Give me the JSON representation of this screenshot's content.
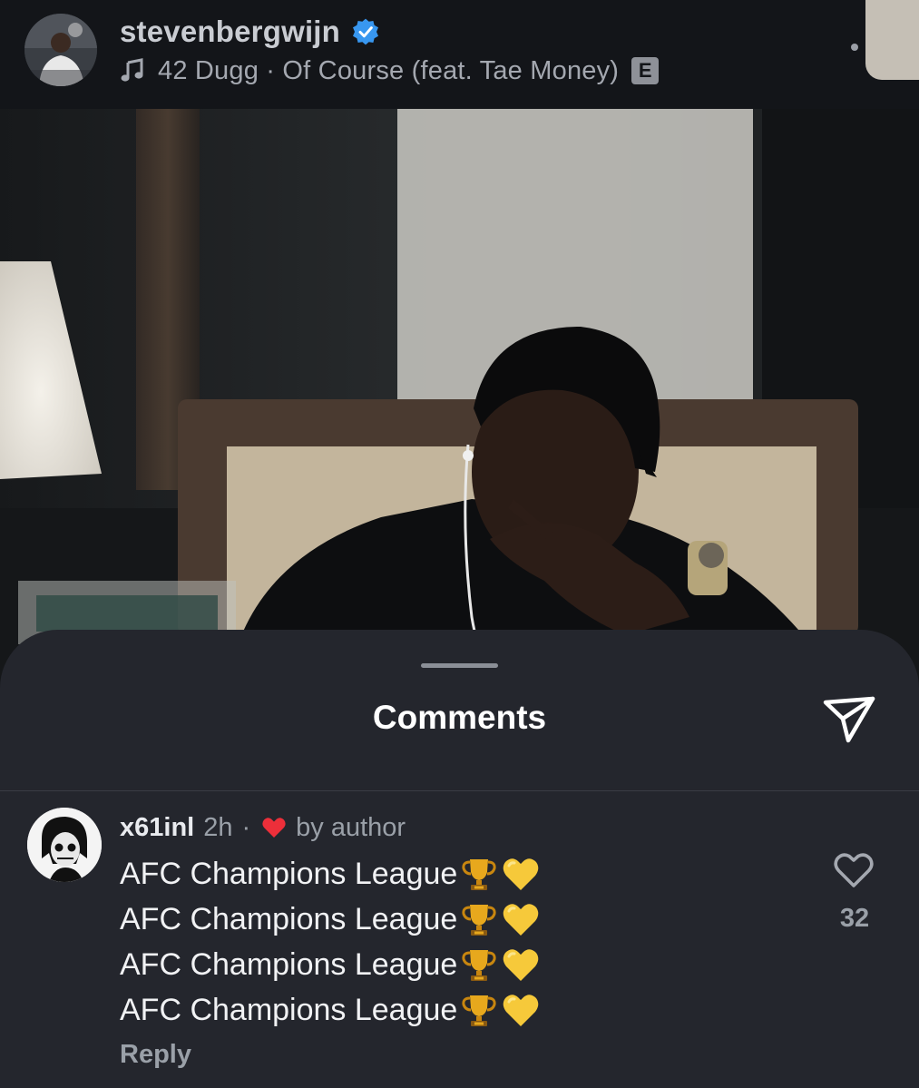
{
  "header": {
    "username": "stevenbergwijn",
    "music_track": "42 Dugg · Of Course (feat. Tae Money)",
    "explicit_badge": "E"
  },
  "comments_sheet": {
    "title": "Comments",
    "comment": {
      "username": "x61inl",
      "time": "2h",
      "separator": "·",
      "liked_by": "by author",
      "lines": [
        "AFC Champions League",
        "AFC Champions League",
        "AFC Champions League",
        "AFC Champions League"
      ],
      "reply_label": "Reply",
      "like_count": "32"
    }
  },
  "colors": {
    "background": "#121418",
    "sheet": "#24262d",
    "verified": "#3897f0",
    "heart_red": "#ed2f3a",
    "text_muted": "#9aa0a8"
  },
  "icons": {
    "verified": "verified-badge-icon",
    "music": "music-note-icon",
    "share": "paper-plane-icon",
    "like": "heart-outline-icon",
    "author_like": "red-heart-icon",
    "emoji_trophy": "trophy-emoji",
    "emoji_heart": "yellow-heart-emoji"
  }
}
